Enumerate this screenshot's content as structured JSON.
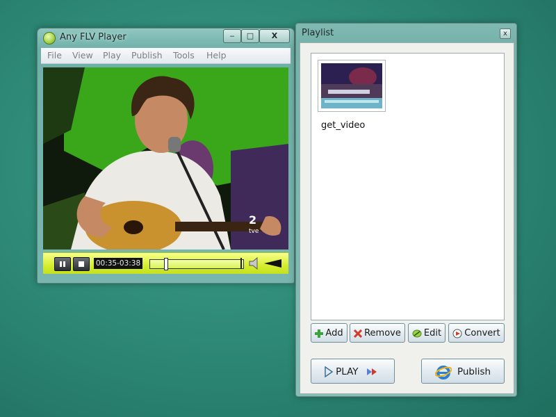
{
  "player": {
    "title": "Any FLV Player",
    "controls": {
      "minimize": "‒",
      "maximize": "□",
      "close": "X"
    },
    "menu": [
      "File",
      "View",
      "Play",
      "Publish",
      "Tools",
      "Help"
    ],
    "video_watermark": "2\ntve",
    "time": "00:35-03:38",
    "progress": 0.16,
    "volume_level": 0.9
  },
  "playlist": {
    "title": "Playlist",
    "close": "x",
    "items": [
      {
        "name": "get_video"
      }
    ],
    "buttons": {
      "add": "Add",
      "remove": "Remove",
      "edit": "Edit",
      "convert": "Convert",
      "play": "PLAY",
      "publish": "Publish"
    }
  },
  "colors": {
    "desktop": "#2f8b78",
    "controlbar": "#d5ee2f",
    "accent_red": "#d23a2a"
  }
}
